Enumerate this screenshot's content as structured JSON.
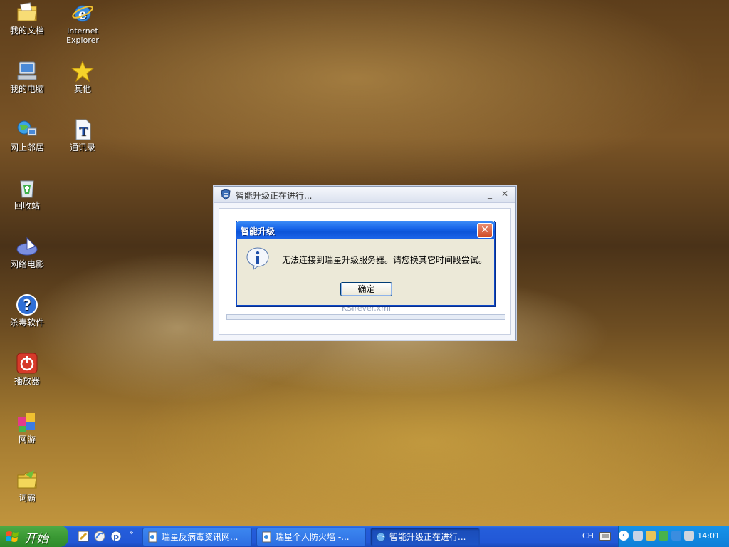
{
  "desktop": {
    "icons": [
      {
        "label": "我的文档",
        "icon": "my-documents-icon"
      },
      {
        "label": "Internet\nExplorer",
        "icon": "internet-explorer-icon"
      },
      {
        "label": "我的电脑",
        "icon": "my-computer-icon"
      },
      {
        "label": "其他",
        "icon": "star-icon"
      },
      {
        "label": "网上邻居",
        "icon": "network-places-icon"
      },
      {
        "label": "通讯录",
        "icon": "address-book-icon"
      },
      {
        "label": "回收站",
        "icon": "recycle-bin-icon"
      },
      {
        "label": "网络电影",
        "icon": "network-movie-icon"
      },
      {
        "label": "杀毒软件",
        "icon": "help-question-icon"
      },
      {
        "label": "播放器",
        "icon": "power-icon"
      },
      {
        "label": "网游",
        "icon": "game-cubes-icon"
      },
      {
        "label": "词霸",
        "icon": "folder-icon"
      }
    ]
  },
  "background_window": {
    "title": "智能升级正在进行...",
    "file_label": "KSIrever.xml"
  },
  "dialog": {
    "title": "智能升级",
    "message": "无法连接到瑞星升级服务器。请您换其它时间段尝试。",
    "ok_label": "确定"
  },
  "taskbar": {
    "start_label": "开始",
    "tasks": [
      {
        "label": "瑞星反病毒资讯网...",
        "active": false
      },
      {
        "label": "瑞星个人防火墙 -...",
        "active": false
      },
      {
        "label": "智能升级正在进行...",
        "active": true
      }
    ],
    "quicklaunch_more": "»",
    "language": "CH",
    "clock": "14:01"
  },
  "colors": {
    "dialog_title_blue": "#1462e8",
    "start_green": "#3b9a35",
    "taskbar_blue": "#245edb",
    "close_red": "#cf4a26"
  }
}
